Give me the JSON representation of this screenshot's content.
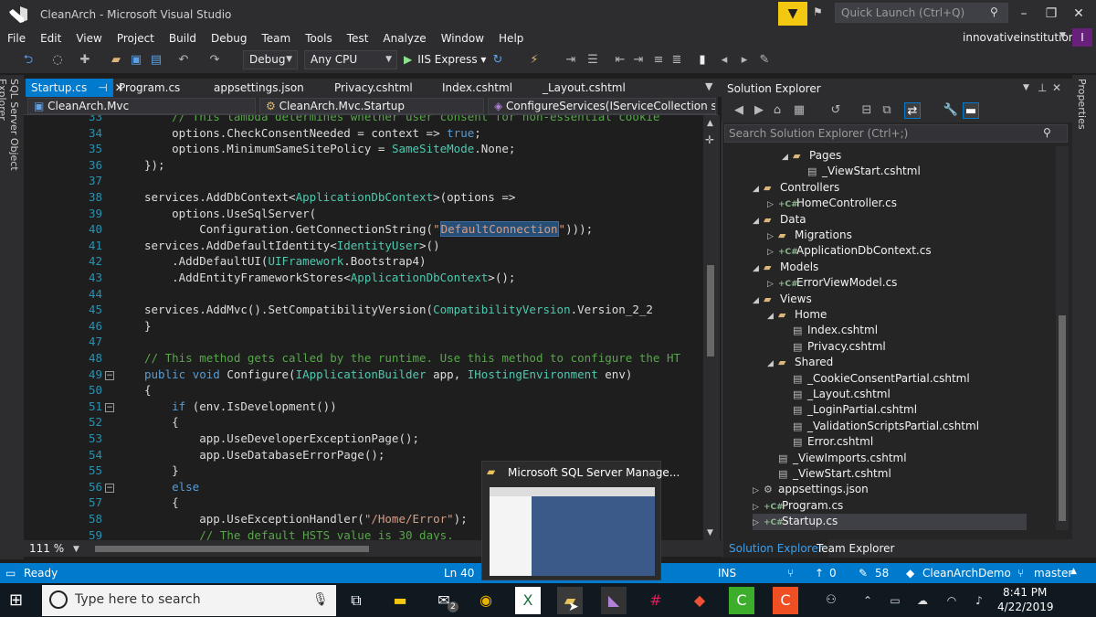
{
  "window": {
    "title": "CleanArch - Microsoft Visual Studio"
  },
  "quick_launch": {
    "placeholder": "Quick Launch (Ctrl+Q)"
  },
  "menu": [
    "File",
    "Edit",
    "View",
    "Project",
    "Build",
    "Debug",
    "Team",
    "Tools",
    "Test",
    "Analyze",
    "Window",
    "Help"
  ],
  "account": {
    "name": "innovativeinstitution",
    "initials": "I"
  },
  "toolbar": {
    "config": "Debug",
    "platform": "Any CPU",
    "run_label": "IIS Express"
  },
  "side_tabs": {
    "left": "SQL Server Object Explorer",
    "right": "Properties"
  },
  "doc_tabs": [
    "Startup.cs",
    "Program.cs",
    "appsettings.json",
    "Privacy.cshtml",
    "Index.cshtml",
    "_Layout.cshtml"
  ],
  "nav": {
    "project": "CleanArch.Mvc",
    "class": "CleanArch.Mvc.Startup",
    "member": "ConfigureServices(IServiceCollection services)"
  },
  "editor": {
    "zoom": "111 %",
    "lines": [
      {
        "n": "33",
        "code": "    // This lambda determines whether user consent for non-essential cookie"
      },
      {
        "n": "34",
        "code": "    options.CheckConsentNeeded = context => true;"
      },
      {
        "n": "35",
        "code": "    options.MinimumSameSitePolicy = SameSiteMode.None;"
      },
      {
        "n": "36",
        "code": "});"
      },
      {
        "n": "37",
        "code": ""
      },
      {
        "n": "38",
        "code": "services.AddDbContext<ApplicationDbContext>(options =>"
      },
      {
        "n": "39",
        "code": "    options.UseSqlServer("
      },
      {
        "n": "40",
        "code": "        Configuration.GetConnectionString(\"DefaultConnection\")));"
      },
      {
        "n": "41",
        "code": "services.AddDefaultIdentity<IdentityUser>()"
      },
      {
        "n": "42",
        "code": "    .AddDefaultUI(UIFramework.Bootstrap4)"
      },
      {
        "n": "43",
        "code": "    .AddEntityFrameworkStores<ApplicationDbContext>();"
      },
      {
        "n": "44",
        "code": ""
      },
      {
        "n": "45",
        "code": "services.AddMvc().SetCompatibilityVersion(CompatibilityVersion.Version_2_2"
      },
      {
        "n": "46",
        "code": "}"
      },
      {
        "n": "47",
        "code": ""
      },
      {
        "n": "48",
        "code": "// This method gets called by the runtime. Use this method to configure the HT"
      },
      {
        "n": "49",
        "code": "public void Configure(IApplicationBuilder app, IHostingEnvironment env)"
      },
      {
        "n": "50",
        "code": "{"
      },
      {
        "n": "51",
        "code": "    if (env.IsDevelopment())"
      },
      {
        "n": "52",
        "code": "    {"
      },
      {
        "n": "53",
        "code": "        app.UseDeveloperExceptionPage();"
      },
      {
        "n": "54",
        "code": "        app.UseDatabaseErrorPage();"
      },
      {
        "n": "55",
        "code": "    }"
      },
      {
        "n": "56",
        "code": "    else"
      },
      {
        "n": "57",
        "code": "    {"
      },
      {
        "n": "58",
        "code": "        app.UseExceptionHandler(\"/Home/Error\");"
      },
      {
        "n": "59",
        "code": "        // The default HSTS value is 30 days."
      }
    ]
  },
  "solution_explorer": {
    "title": "Solution Explorer",
    "search_placeholder": "Search Solution Explorer (Ctrl+;)",
    "tree": [
      {
        "label": "Pages",
        "kind": "folder",
        "depth": 3,
        "expanded": true
      },
      {
        "label": "_ViewStart.cshtml",
        "kind": "page",
        "depth": 4
      },
      {
        "label": "Controllers",
        "kind": "folder",
        "depth": 1,
        "expanded": true
      },
      {
        "label": "HomeController.cs",
        "kind": "cs",
        "depth": 2
      },
      {
        "label": "Data",
        "kind": "folder",
        "depth": 1,
        "expanded": true
      },
      {
        "label": "Migrations",
        "kind": "folder",
        "depth": 2,
        "expanded": false
      },
      {
        "label": "ApplicationDbContext.cs",
        "kind": "cs",
        "depth": 2
      },
      {
        "label": "Models",
        "kind": "folder",
        "depth": 1,
        "expanded": true
      },
      {
        "label": "ErrorViewModel.cs",
        "kind": "cs",
        "depth": 2
      },
      {
        "label": "Views",
        "kind": "folder",
        "depth": 1,
        "expanded": true
      },
      {
        "label": "Home",
        "kind": "folder",
        "depth": 2,
        "expanded": true
      },
      {
        "label": "Index.cshtml",
        "kind": "page",
        "depth": 3
      },
      {
        "label": "Privacy.cshtml",
        "kind": "page",
        "depth": 3
      },
      {
        "label": "Shared",
        "kind": "folder",
        "depth": 2,
        "expanded": true
      },
      {
        "label": "_CookieConsentPartial.cshtml",
        "kind": "page",
        "depth": 3
      },
      {
        "label": "_Layout.cshtml",
        "kind": "page",
        "depth": 3
      },
      {
        "label": "_LoginPartial.cshtml",
        "kind": "page",
        "depth": 3
      },
      {
        "label": "_ValidationScriptsPartial.cshtml",
        "kind": "page",
        "depth": 3
      },
      {
        "label": "Error.cshtml",
        "kind": "page",
        "depth": 3
      },
      {
        "label": "_ViewImports.cshtml",
        "kind": "page",
        "depth": 2
      },
      {
        "label": "_ViewStart.cshtml",
        "kind": "page",
        "depth": 2
      },
      {
        "label": "appsettings.json",
        "kind": "json",
        "depth": 1
      },
      {
        "label": "Program.cs",
        "kind": "cs",
        "depth": 1
      },
      {
        "label": "Startup.cs",
        "kind": "cs",
        "depth": 1,
        "selected": true
      }
    ],
    "tabs": [
      "Solution Explorer",
      "Team Explorer"
    ]
  },
  "status": {
    "ready": "Ready",
    "ln": "Ln 40",
    "ins": "INS",
    "up": "0",
    "edits": "58",
    "repo": "CleanArchDemo",
    "branch": "master"
  },
  "taskbar": {
    "search_placeholder": "Type here to search",
    "time": "8:41 PM",
    "date": "4/22/2019",
    "mail_badge": "2"
  },
  "popup": {
    "title": "Microsoft SQL Server Manage..."
  },
  "colors": {
    "accent": "#007acc",
    "brand": "#68217a",
    "keyword": "#569cd6",
    "type": "#4ec9b0",
    "string": "#d69d85",
    "comment": "#57a64a",
    "linenum": "#2b91af"
  }
}
